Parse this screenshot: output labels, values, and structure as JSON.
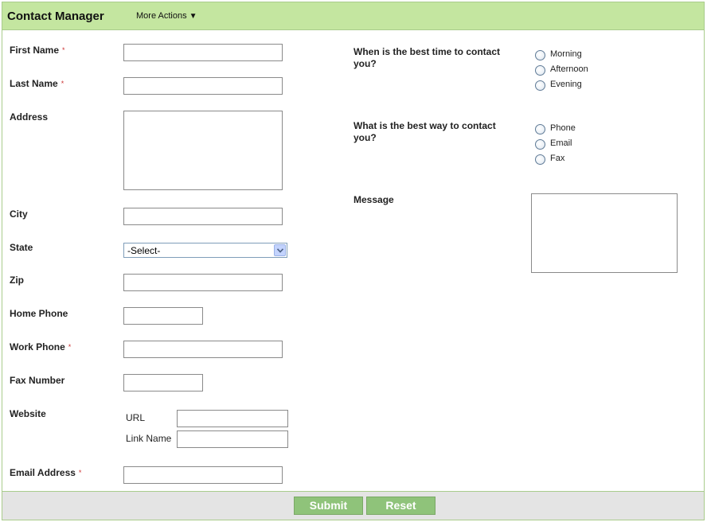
{
  "header": {
    "title": "Contact Manager",
    "more_actions": "More Actions"
  },
  "required_marker": "*",
  "fields": {
    "first_name": "First Name",
    "last_name": "Last Name",
    "address": "Address",
    "city": "City",
    "state": "State",
    "state_selected": "-Select-",
    "zip": "Zip",
    "home_phone": "Home Phone",
    "work_phone": "Work Phone",
    "fax_number": "Fax Number",
    "website": "Website",
    "url": "URL",
    "link_name": "Link Name",
    "email_address": "Email Address"
  },
  "contact_time": {
    "question": "When is the best time to contact you?",
    "options": [
      "Morning",
      "Afternoon",
      "Evening"
    ]
  },
  "contact_way": {
    "question": "What is the best way to contact you?",
    "options": [
      "Phone",
      "Email",
      "Fax"
    ]
  },
  "message_label": "Message",
  "footer": {
    "submit": "Submit",
    "reset": "Reset"
  },
  "colors": {
    "header_bg": "#c4e6a0",
    "button_bg": "#8fc37a",
    "required": "#cc3333"
  },
  "icons": {
    "dropdown": "chevron-down-icon",
    "more_actions": "caret-down-icon"
  }
}
